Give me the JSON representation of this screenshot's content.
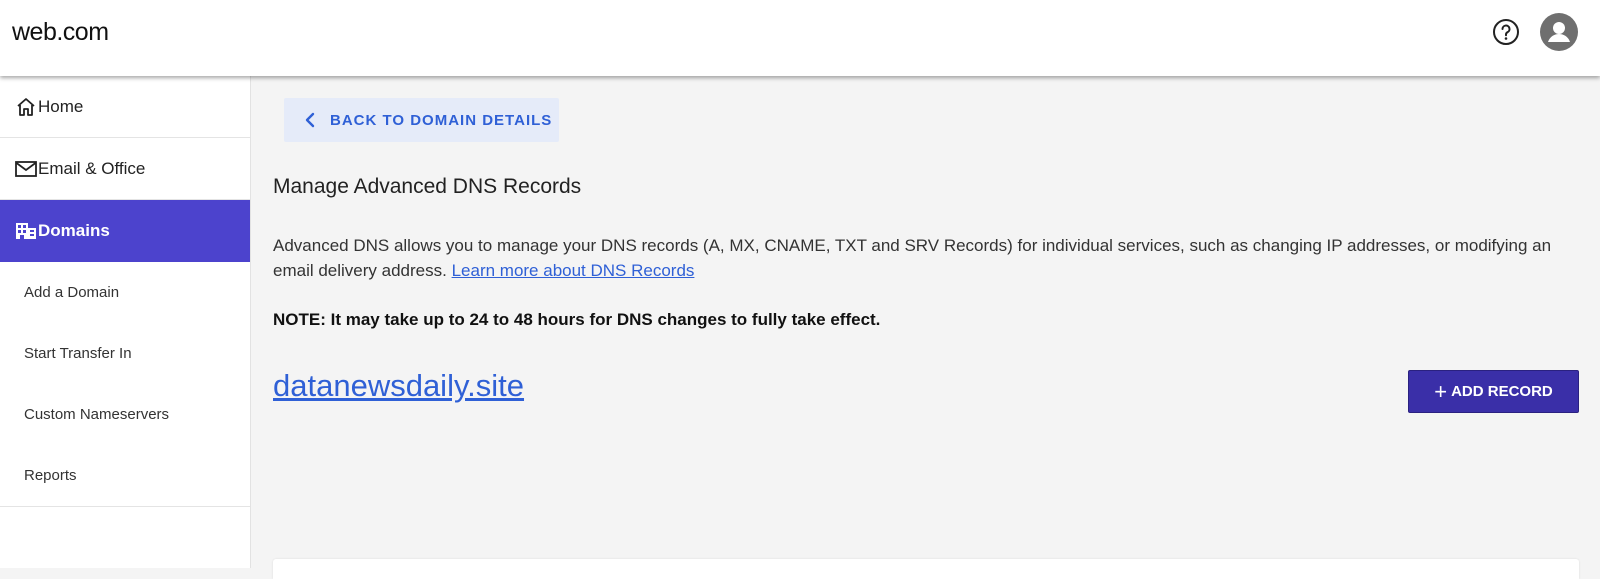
{
  "header": {
    "brand": "web.com",
    "help_icon": "help-circle-icon",
    "avatar_icon": "user-avatar-icon"
  },
  "sidebar": {
    "items": [
      {
        "label": "Home",
        "icon": "home-icon"
      },
      {
        "label": "Email & Office",
        "icon": "mail-icon"
      },
      {
        "label": "Domains",
        "icon": "building-icon",
        "active": true
      }
    ],
    "sub_items": [
      {
        "label": "Add a Domain"
      },
      {
        "label": "Start Transfer In"
      },
      {
        "label": "Custom Nameservers"
      },
      {
        "label": "Reports"
      }
    ]
  },
  "main": {
    "back_label": "BACK TO DOMAIN DETAILS",
    "title": "Manage Advanced DNS Records",
    "description": "Advanced DNS allows you to manage your DNS records (A, MX, CNAME, TXT and SRV Records) for individual services, such as changing IP addresses, or modifying an email delivery address. ",
    "learn_more": "Learn more about DNS Records",
    "note": "NOTE: It may take up to 24 to 48 hours for DNS changes to fully take effect.",
    "domain": "datanewsdaily.site",
    "add_record_label": "ADD RECORD"
  },
  "colors": {
    "accent_active": "#4c43cd",
    "button_primary": "#3a2fa8",
    "link": "#2f60d6",
    "back_button_bg": "#e5ebf9",
    "page_bg": "#f4f4f4"
  }
}
